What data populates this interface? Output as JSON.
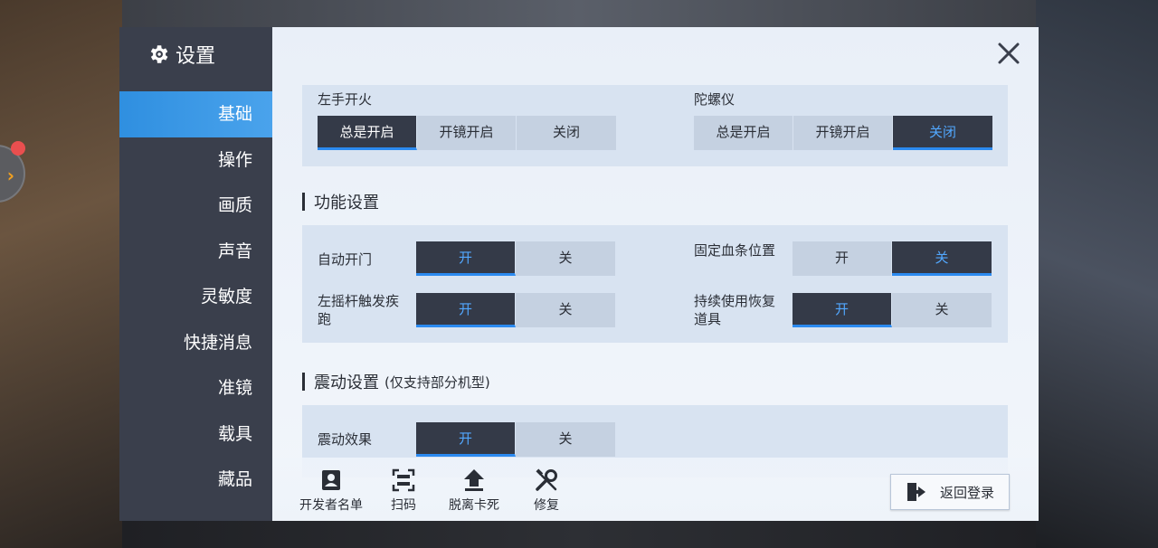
{
  "sidebar": {
    "title": "设置",
    "items": [
      "基础",
      "操作",
      "画质",
      "声音",
      "灵敏度",
      "快捷消息",
      "准镜",
      "载具",
      "藏品"
    ],
    "active_index": 0
  },
  "fire": {
    "label": "左手开火",
    "options": [
      "总是开启",
      "开镜开启",
      "关闭"
    ],
    "selected": 0
  },
  "gyro": {
    "label": "陀螺仪",
    "options": [
      "总是开启",
      "开镜开启",
      "关闭"
    ],
    "selected": 2
  },
  "func": {
    "title": "功能设置",
    "auto_door": {
      "label": "自动开门",
      "on": "开",
      "off": "关",
      "selected": "on"
    },
    "fixed_hp": {
      "label": "固定血条位置",
      "on": "开",
      "off": "关",
      "selected": "off"
    },
    "left_stick": {
      "label": "左摇杆触发疾跑",
      "on": "开",
      "off": "关",
      "selected": "on"
    },
    "heal": {
      "label": "持续使用恢复道具",
      "on": "开",
      "off": "关",
      "selected": "on"
    }
  },
  "vib": {
    "title": "震动设置",
    "subtitle": "(仅支持部分机型)",
    "effect": {
      "label": "震动效果",
      "on": "开",
      "off": "关",
      "selected": "on"
    }
  },
  "bottom": {
    "dev_list": "开发者名单",
    "scan": "扫码",
    "unstuck": "脱离卡死",
    "repair": "修复",
    "back_login": "返回登录"
  },
  "colors": {
    "accent": "#2b8af0",
    "sidebar_bg": "#3a3f4c",
    "seg_selected_bg": "#343a48"
  }
}
